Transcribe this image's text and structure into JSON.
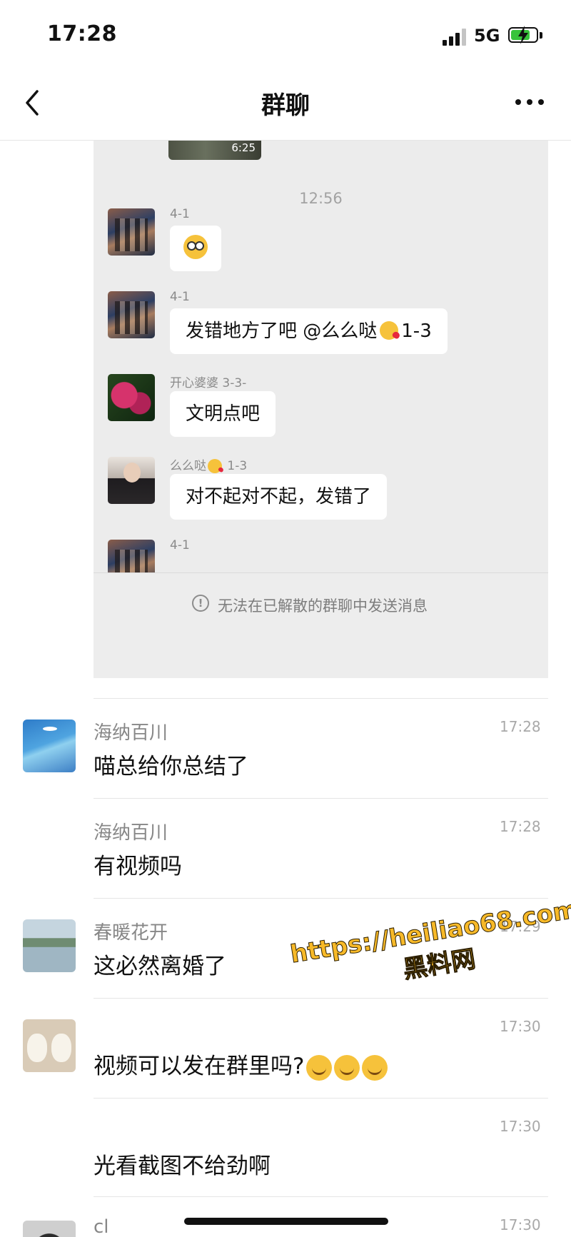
{
  "status_bar": {
    "time": "17:28",
    "network": "5G"
  },
  "nav": {
    "title": "群聊"
  },
  "embedded_chat": {
    "video_duration": "6:25",
    "timestamp": "12:56",
    "messages": [
      {
        "sender": "4-1",
        "text": ""
      },
      {
        "sender": "4-1",
        "text": "发错地方了吧 @么么哒",
        "suffix": "1-3"
      },
      {
        "sender": "开心婆婆 3-3-",
        "text": "文明点吧"
      },
      {
        "sender": "么么哒",
        "sender_suffix": "1-3",
        "text": "对不起对不起，发错了"
      },
      {
        "sender": "4-1",
        "text": ""
      }
    ],
    "notice": "无法在已解散的群聊中发送消息"
  },
  "replies": [
    {
      "name": "海纳百川",
      "time": "17:28",
      "text": "喵总给你总结了"
    },
    {
      "name": "海纳百川",
      "time": "17:28",
      "text": "有视频吗"
    },
    {
      "name": "春暖花开",
      "time": "17:29",
      "text": "这必然离婚了"
    },
    {
      "name": "",
      "time": "17:30",
      "text": "视频可以发在群里吗?"
    },
    {
      "name": "",
      "time": "17:30",
      "text": "光看截图不给劲啊"
    },
    {
      "name": "cl",
      "time": "17:30",
      "text": ""
    }
  ],
  "watermark": {
    "line1": "https://heiliao68.com",
    "line2": "黑料网"
  }
}
